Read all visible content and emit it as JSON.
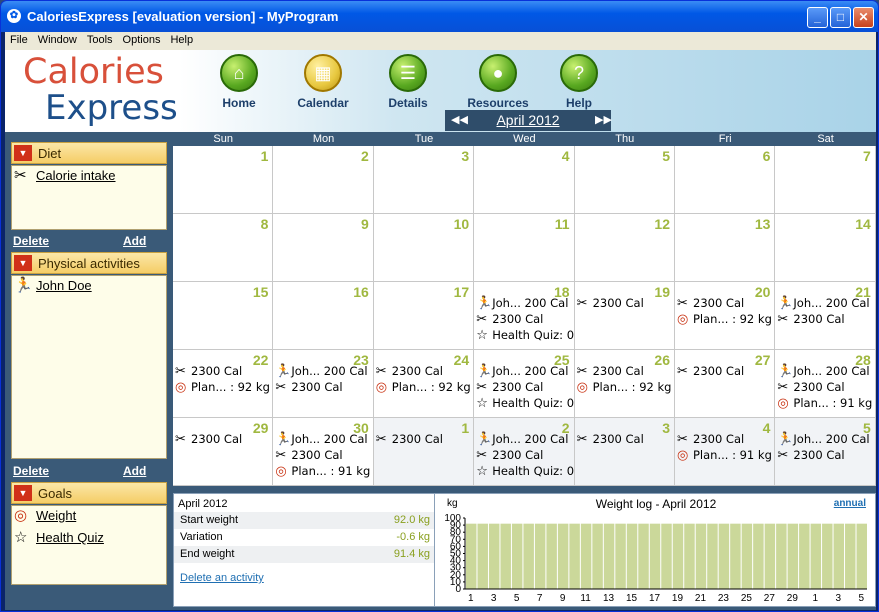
{
  "window": {
    "title": "CaloriesExpress [evaluation version] - MyProgram"
  },
  "menu": [
    "File",
    "Window",
    "Tools",
    "Options",
    "Help"
  ],
  "logo": {
    "line1": "Calories",
    "line2": "Express"
  },
  "nav": [
    {
      "label": "Home",
      "icon": "home-icon"
    },
    {
      "label": "Calendar",
      "icon": "calendar-icon"
    },
    {
      "label": "Details",
      "icon": "details-icon"
    },
    {
      "label": "Resources",
      "icon": "apple-icon"
    },
    {
      "label": "Help",
      "icon": "help-icon"
    }
  ],
  "month": {
    "label": "April 2012"
  },
  "sidebar": {
    "diet": {
      "title": "Diet",
      "items": [
        {
          "label": "Calorie intake",
          "icon": "fork-knife-icon"
        }
      ]
    },
    "activities": {
      "title": "Physical activities",
      "items": [
        {
          "label": "John Doe",
          "icon": "runner-icon"
        }
      ]
    },
    "goals": {
      "title": "Goals",
      "items": [
        {
          "label": "Weight",
          "icon": "target-icon"
        },
        {
          "label": "Health Quiz",
          "icon": "star-icon"
        }
      ]
    },
    "delete_label": "Delete",
    "add_label": "Add"
  },
  "calendar": {
    "days": [
      "Sun",
      "Mon",
      "Tue",
      "Wed",
      "Thu",
      "Fri",
      "Sat"
    ],
    "weeks": [
      [
        {
          "n": "1",
          "ev": []
        },
        {
          "n": "2",
          "ev": []
        },
        {
          "n": "3",
          "ev": []
        },
        {
          "n": "4",
          "ev": []
        },
        {
          "n": "5",
          "ev": []
        },
        {
          "n": "6",
          "ev": []
        },
        {
          "n": "7",
          "ev": []
        }
      ],
      [
        {
          "n": "8",
          "ev": []
        },
        {
          "n": "9",
          "ev": []
        },
        {
          "n": "10",
          "ev": []
        },
        {
          "n": "11",
          "ev": []
        },
        {
          "n": "12",
          "ev": []
        },
        {
          "n": "13",
          "ev": []
        },
        {
          "n": "14",
          "ev": []
        }
      ],
      [
        {
          "n": "15",
          "ev": []
        },
        {
          "n": "16",
          "ev": []
        },
        {
          "n": "17",
          "ev": []
        },
        {
          "n": "18",
          "ev": [
            {
              "i": "R",
              "t": "Joh... 200 Cal"
            },
            {
              "i": "F",
              "t": "2300 Cal"
            },
            {
              "i": "S",
              "t": "Health Quiz: 0"
            }
          ]
        },
        {
          "n": "19",
          "ev": [
            {
              "i": "F",
              "t": "2300 Cal"
            }
          ]
        },
        {
          "n": "20",
          "ev": [
            {
              "i": "F",
              "t": "2300 Cal"
            },
            {
              "i": "T",
              "t": "Plan... : 92 kg"
            }
          ]
        },
        {
          "n": "21",
          "ev": [
            {
              "i": "R",
              "t": "Joh... 200 Cal"
            },
            {
              "i": "F",
              "t": "2300 Cal"
            }
          ]
        }
      ],
      [
        {
          "n": "22",
          "ev": [
            {
              "i": "F",
              "t": "2300 Cal"
            },
            {
              "i": "T",
              "t": "Plan... : 92 kg"
            }
          ]
        },
        {
          "n": "23",
          "ev": [
            {
              "i": "R",
              "t": "Joh... 200 Cal"
            },
            {
              "i": "F",
              "t": "2300 Cal"
            }
          ]
        },
        {
          "n": "24",
          "ev": [
            {
              "i": "F",
              "t": "2300 Cal"
            },
            {
              "i": "T",
              "t": "Plan... : 92 kg"
            }
          ]
        },
        {
          "n": "25",
          "ev": [
            {
              "i": "R",
              "t": "Joh... 200 Cal"
            },
            {
              "i": "F",
              "t": "2300 Cal"
            },
            {
              "i": "S",
              "t": "Health Quiz: 0"
            }
          ]
        },
        {
          "n": "26",
          "ev": [
            {
              "i": "F",
              "t": "2300 Cal"
            },
            {
              "i": "T",
              "t": "Plan... : 92 kg"
            }
          ]
        },
        {
          "n": "27",
          "ev": [
            {
              "i": "F",
              "t": "2300 Cal"
            }
          ]
        },
        {
          "n": "28",
          "ev": [
            {
              "i": "R",
              "t": "Joh... 200 Cal"
            },
            {
              "i": "F",
              "t": "2300 Cal"
            },
            {
              "i": "T",
              "t": "Plan... : 91 kg"
            }
          ]
        }
      ],
      [
        {
          "n": "29",
          "ev": [
            {
              "i": "F",
              "t": "2300 Cal"
            }
          ]
        },
        {
          "n": "30",
          "ev": [
            {
              "i": "R",
              "t": "Joh... 200 Cal"
            },
            {
              "i": "F",
              "t": "2300 Cal"
            },
            {
              "i": "T",
              "t": "Plan... : 91 kg"
            }
          ]
        },
        {
          "n": "1",
          "o": true,
          "ev": [
            {
              "i": "F",
              "t": "2300 Cal"
            }
          ]
        },
        {
          "n": "2",
          "o": true,
          "ev": [
            {
              "i": "R",
              "t": "Joh... 200 Cal"
            },
            {
              "i": "F",
              "t": "2300 Cal"
            },
            {
              "i": "S",
              "t": "Health Quiz: 0"
            }
          ]
        },
        {
          "n": "3",
          "o": true,
          "ev": [
            {
              "i": "F",
              "t": "2300 Cal"
            }
          ]
        },
        {
          "n": "4",
          "o": true,
          "ev": [
            {
              "i": "F",
              "t": "2300 Cal"
            },
            {
              "i": "T",
              "t": "Plan... : 91 kg"
            }
          ]
        },
        {
          "n": "5",
          "o": true,
          "ev": [
            {
              "i": "R",
              "t": "Joh... 200 Cal"
            },
            {
              "i": "F",
              "t": "2300 Cal"
            }
          ]
        }
      ]
    ]
  },
  "summary": {
    "title": "April 2012",
    "rows": [
      {
        "label": "Start weight",
        "value": "92.0 kg"
      },
      {
        "label": "Variation",
        "value": "-0.6 kg"
      },
      {
        "label": "End weight",
        "value": "91.4 kg"
      }
    ],
    "link": "Delete an activity"
  },
  "colors": {
    "bar": "#cbd89a",
    "accent": "#a0b840"
  },
  "chart_data": {
    "type": "bar",
    "title": "Weight log - April 2012",
    "ylabel": "kg",
    "ylim": [
      0,
      100
    ],
    "yticks": [
      "0",
      "10",
      "20",
      "30",
      "40",
      "50",
      "60",
      "70",
      "80",
      "90",
      "100"
    ],
    "categories": [
      "1",
      "2",
      "3",
      "4",
      "5",
      "6",
      "7",
      "8",
      "9",
      "10",
      "11",
      "12",
      "13",
      "14",
      "15",
      "16",
      "17",
      "18",
      "19",
      "20",
      "21",
      "22",
      "23",
      "24",
      "25",
      "26",
      "27",
      "28",
      "29",
      "30",
      "1",
      "2",
      "3",
      "4",
      "5"
    ],
    "xticks": [
      "1",
      "3",
      "5",
      "7",
      "9",
      "11",
      "13",
      "15",
      "17",
      "19",
      "21",
      "23",
      "25",
      "27",
      "29",
      "1",
      "3",
      "5"
    ],
    "values": [
      92,
      92,
      92,
      92,
      92,
      92,
      92,
      92,
      92,
      92,
      92,
      92,
      92,
      92,
      92,
      92,
      92,
      92,
      92,
      92,
      92,
      92,
      92,
      92,
      92,
      92,
      92,
      92,
      92,
      92,
      92,
      92,
      92,
      92,
      92
    ],
    "link": "annual"
  }
}
